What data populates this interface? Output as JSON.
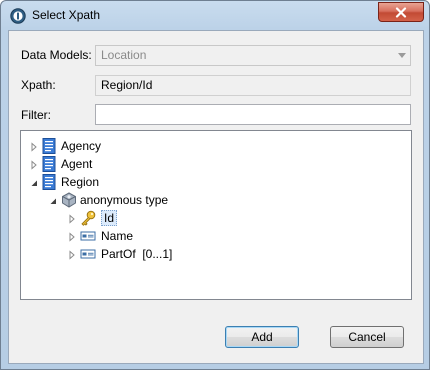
{
  "window": {
    "title": "Select Xpath"
  },
  "form": {
    "data_models_label": "Data Models:",
    "data_models_value": "Location",
    "xpath_label": "Xpath:",
    "xpath_value": "Region/Id",
    "filter_label": "Filter:",
    "filter_value": ""
  },
  "tree": {
    "items": [
      {
        "label": "Agency",
        "icon": "document-icon",
        "expanded": false
      },
      {
        "label": "Agent",
        "icon": "document-icon",
        "expanded": false
      },
      {
        "label": "Region",
        "icon": "document-icon",
        "expanded": true
      },
      {
        "label": "anonymous type",
        "icon": "complex-type-icon",
        "expanded": true
      },
      {
        "label": "Id",
        "icon": "key-icon",
        "expanded": false,
        "selected": true
      },
      {
        "label": "Name",
        "icon": "element-icon",
        "expanded": false
      },
      {
        "label": "PartOf  [0...1]",
        "icon": "element-icon",
        "expanded": false
      }
    ]
  },
  "buttons": {
    "add": "Add",
    "cancel": "Cancel"
  },
  "colors": {
    "selection": "#dcebfc",
    "accent": "#3c7fb1",
    "close": "#c24a34"
  }
}
